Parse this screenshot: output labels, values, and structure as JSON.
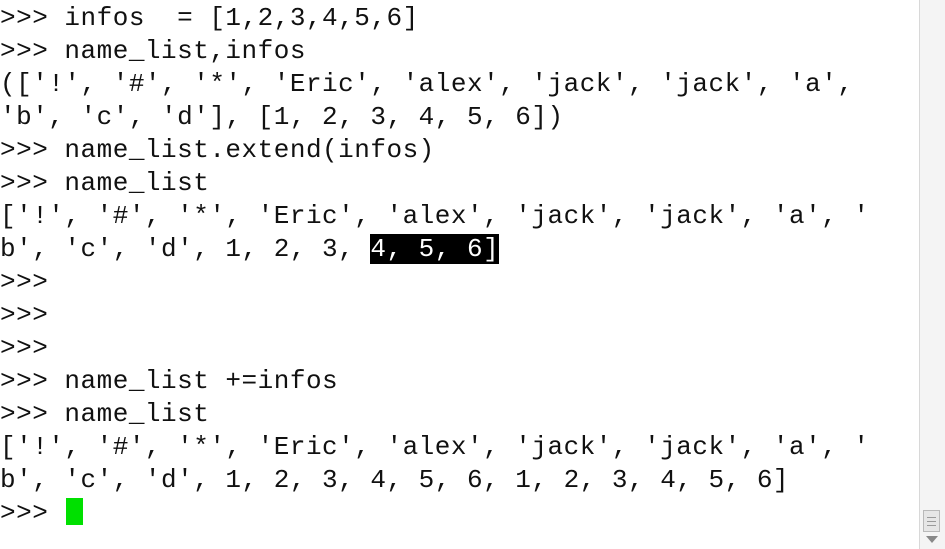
{
  "terminal": {
    "lines": [
      {
        "segments": [
          {
            "text": ">>> infos  = [1,2,3,4,5,6]"
          }
        ]
      },
      {
        "segments": [
          {
            "text": ">>> name_list,infos"
          }
        ]
      },
      {
        "segments": [
          {
            "text": "(['!', '#', '*', 'Eric', 'alex', 'jack', 'jack', 'a',"
          }
        ]
      },
      {
        "segments": [
          {
            "text": "'b', 'c', 'd'], [1, 2, 3, 4, 5, 6])"
          }
        ]
      },
      {
        "segments": [
          {
            "text": ">>> name_list.extend(infos)"
          }
        ]
      },
      {
        "segments": [
          {
            "text": ">>> name_list"
          }
        ]
      },
      {
        "segments": [
          {
            "text": "['!', '#', '*', 'Eric', 'alex', 'jack', 'jack', 'a', '"
          }
        ]
      },
      {
        "segments": [
          {
            "text": "b', 'c', 'd', 1, 2, 3, "
          },
          {
            "text": "4, 5, 6]",
            "selected": true
          }
        ]
      },
      {
        "segments": [
          {
            "text": ">>>"
          }
        ]
      },
      {
        "segments": [
          {
            "text": ">>>"
          }
        ]
      },
      {
        "segments": [
          {
            "text": ">>>"
          }
        ]
      },
      {
        "segments": [
          {
            "text": ">>> name_list +=infos"
          }
        ]
      },
      {
        "segments": [
          {
            "text": ">>> name_list"
          }
        ]
      },
      {
        "segments": [
          {
            "text": "['!', '#', '*', 'Eric', 'alex', 'jack', 'jack', 'a', '"
          }
        ]
      },
      {
        "segments": [
          {
            "text": "b', 'c', 'd', 1, 2, 3, 4, 5, 6, 1, 2, 3, 4, 5, 6]"
          }
        ]
      },
      {
        "segments": [
          {
            "text": ">>> "
          }
        ],
        "cursor": true
      }
    ]
  },
  "colors": {
    "background": "#ffffff",
    "text": "#111111",
    "selection_bg": "#000000",
    "selection_fg": "#ffffff",
    "cursor": "#00e000"
  }
}
